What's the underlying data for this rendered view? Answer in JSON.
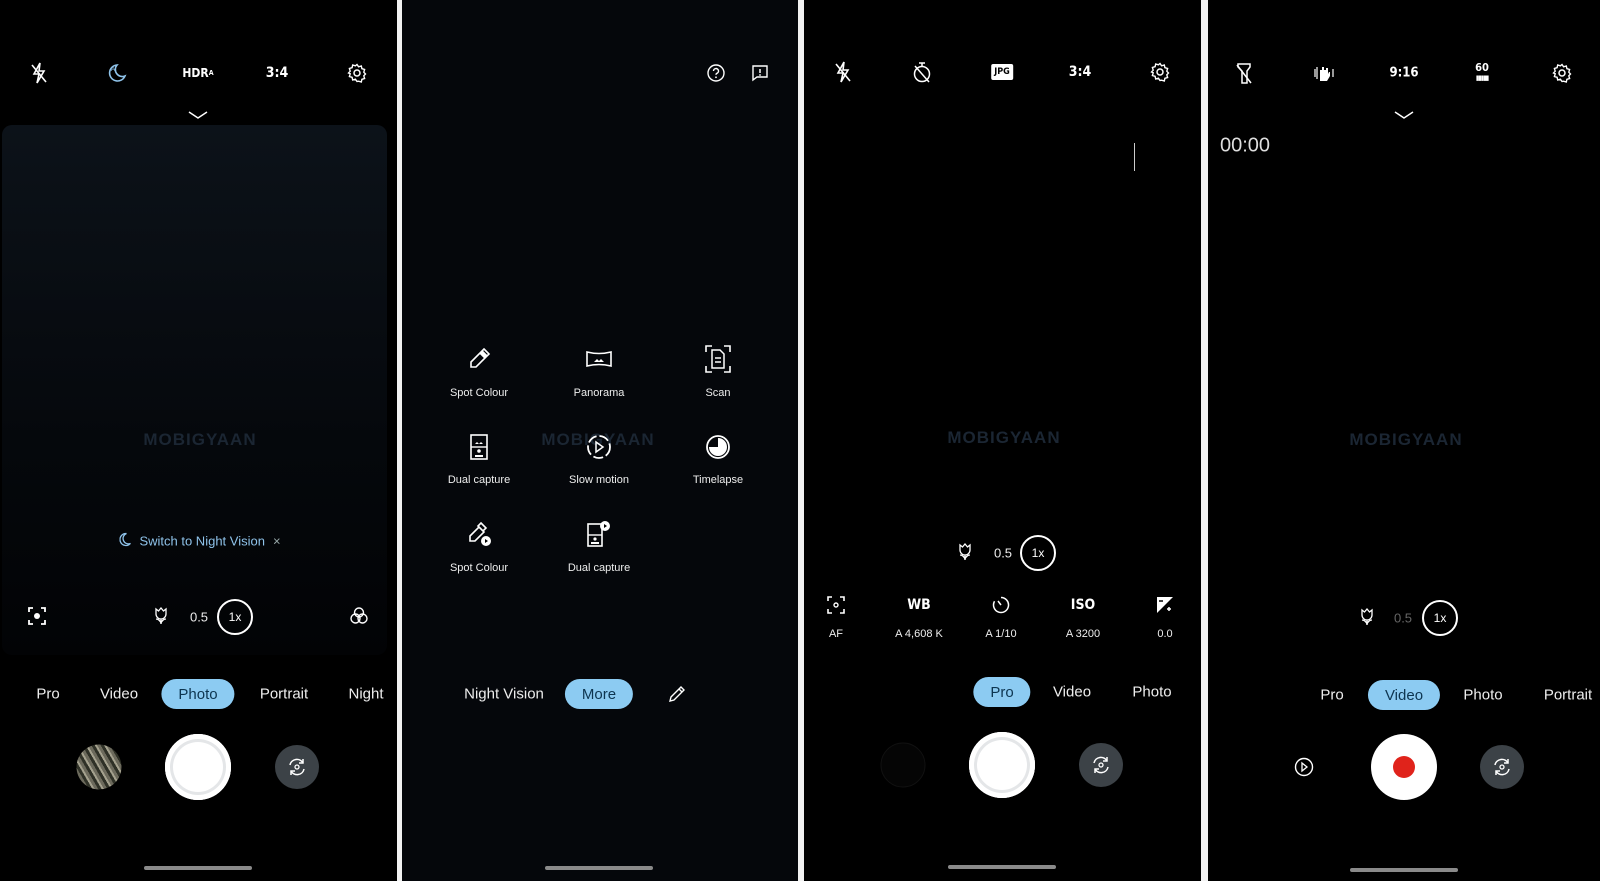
{
  "screens": [
    {
      "top_icons": [
        "flash-off-icon",
        "night-auto-moon-icon",
        "hdr-auto-icon",
        "aspect-ratio",
        "settings-gear-icon"
      ],
      "hdr_label": "HDR",
      "ratio_label": "3:4",
      "watermark": "MOBIGYAAN",
      "toast": {
        "text": "Switch to Night Vision",
        "close": "×"
      },
      "zoom": {
        "macro_icon": "tulip-icon",
        "wide": "0.5",
        "current": "1x"
      },
      "modes": [
        "Pro",
        "Video",
        "Photo",
        "Portrait",
        "Night"
      ],
      "active_mode": "Photo"
    },
    {
      "top_icons": [
        "help-icon",
        "feedback-icon"
      ],
      "watermark": "MOBIGYAAN",
      "grid": [
        {
          "label": "Spot Colour",
          "icon": "dropper-icon"
        },
        {
          "label": "Panorama",
          "icon": "panorama-icon"
        },
        {
          "label": "Scan",
          "icon": "scan-document-icon"
        },
        {
          "label": "Dual capture",
          "icon": "dual-capture-icon"
        },
        {
          "label": "Slow motion",
          "icon": "slow-motion-icon"
        },
        {
          "label": "Timelapse",
          "icon": "timelapse-icon"
        },
        {
          "label": "Spot Colour",
          "icon": "dropper-video-icon"
        },
        {
          "label": "Dual capture",
          "icon": "dual-capture-video-icon"
        }
      ],
      "modes": [
        "Night Vision",
        "More"
      ],
      "active_mode": "More"
    },
    {
      "top_icons": [
        "flash-off-icon",
        "timer-off-icon",
        "jpg-format-icon",
        "aspect-ratio",
        "settings-gear-icon"
      ],
      "jpg_label": "JPG",
      "ratio_label": "3:4",
      "watermark": "MOBIGYAAN",
      "zoom": {
        "wide": "0.5",
        "current": "1x"
      },
      "pro_params": [
        {
          "icon": "focus-icon",
          "label": "AF"
        },
        {
          "icon": "wb-icon",
          "title": "WB",
          "label": "A 4,608 K"
        },
        {
          "icon": "shutter-speed-icon",
          "label": "A 1/10"
        },
        {
          "icon": "iso-icon",
          "title": "ISO",
          "label": "A 3200"
        },
        {
          "icon": "exposure-icon",
          "label": "0.0"
        }
      ],
      "modes": [
        "Pro",
        "Video",
        "Photo"
      ],
      "active_mode": "Pro"
    },
    {
      "top_icons": [
        "torch-off-icon",
        "stabilization-hand-icon",
        "aspect-ratio",
        "frame-rate-icon",
        "settings-gear-icon"
      ],
      "ratio_label": "9:16",
      "fps_label": "60",
      "timer": "00:00",
      "watermark": "MOBIGYAAN",
      "zoom": {
        "wide": "0.5",
        "current": "1x"
      },
      "modes": [
        "Pro",
        "Video",
        "Photo",
        "Portrait"
      ],
      "active_mode": "Video"
    }
  ],
  "colors": {
    "accent": "#8ccbf2",
    "record": "#e0231b",
    "button_gray": "#3c4247"
  }
}
